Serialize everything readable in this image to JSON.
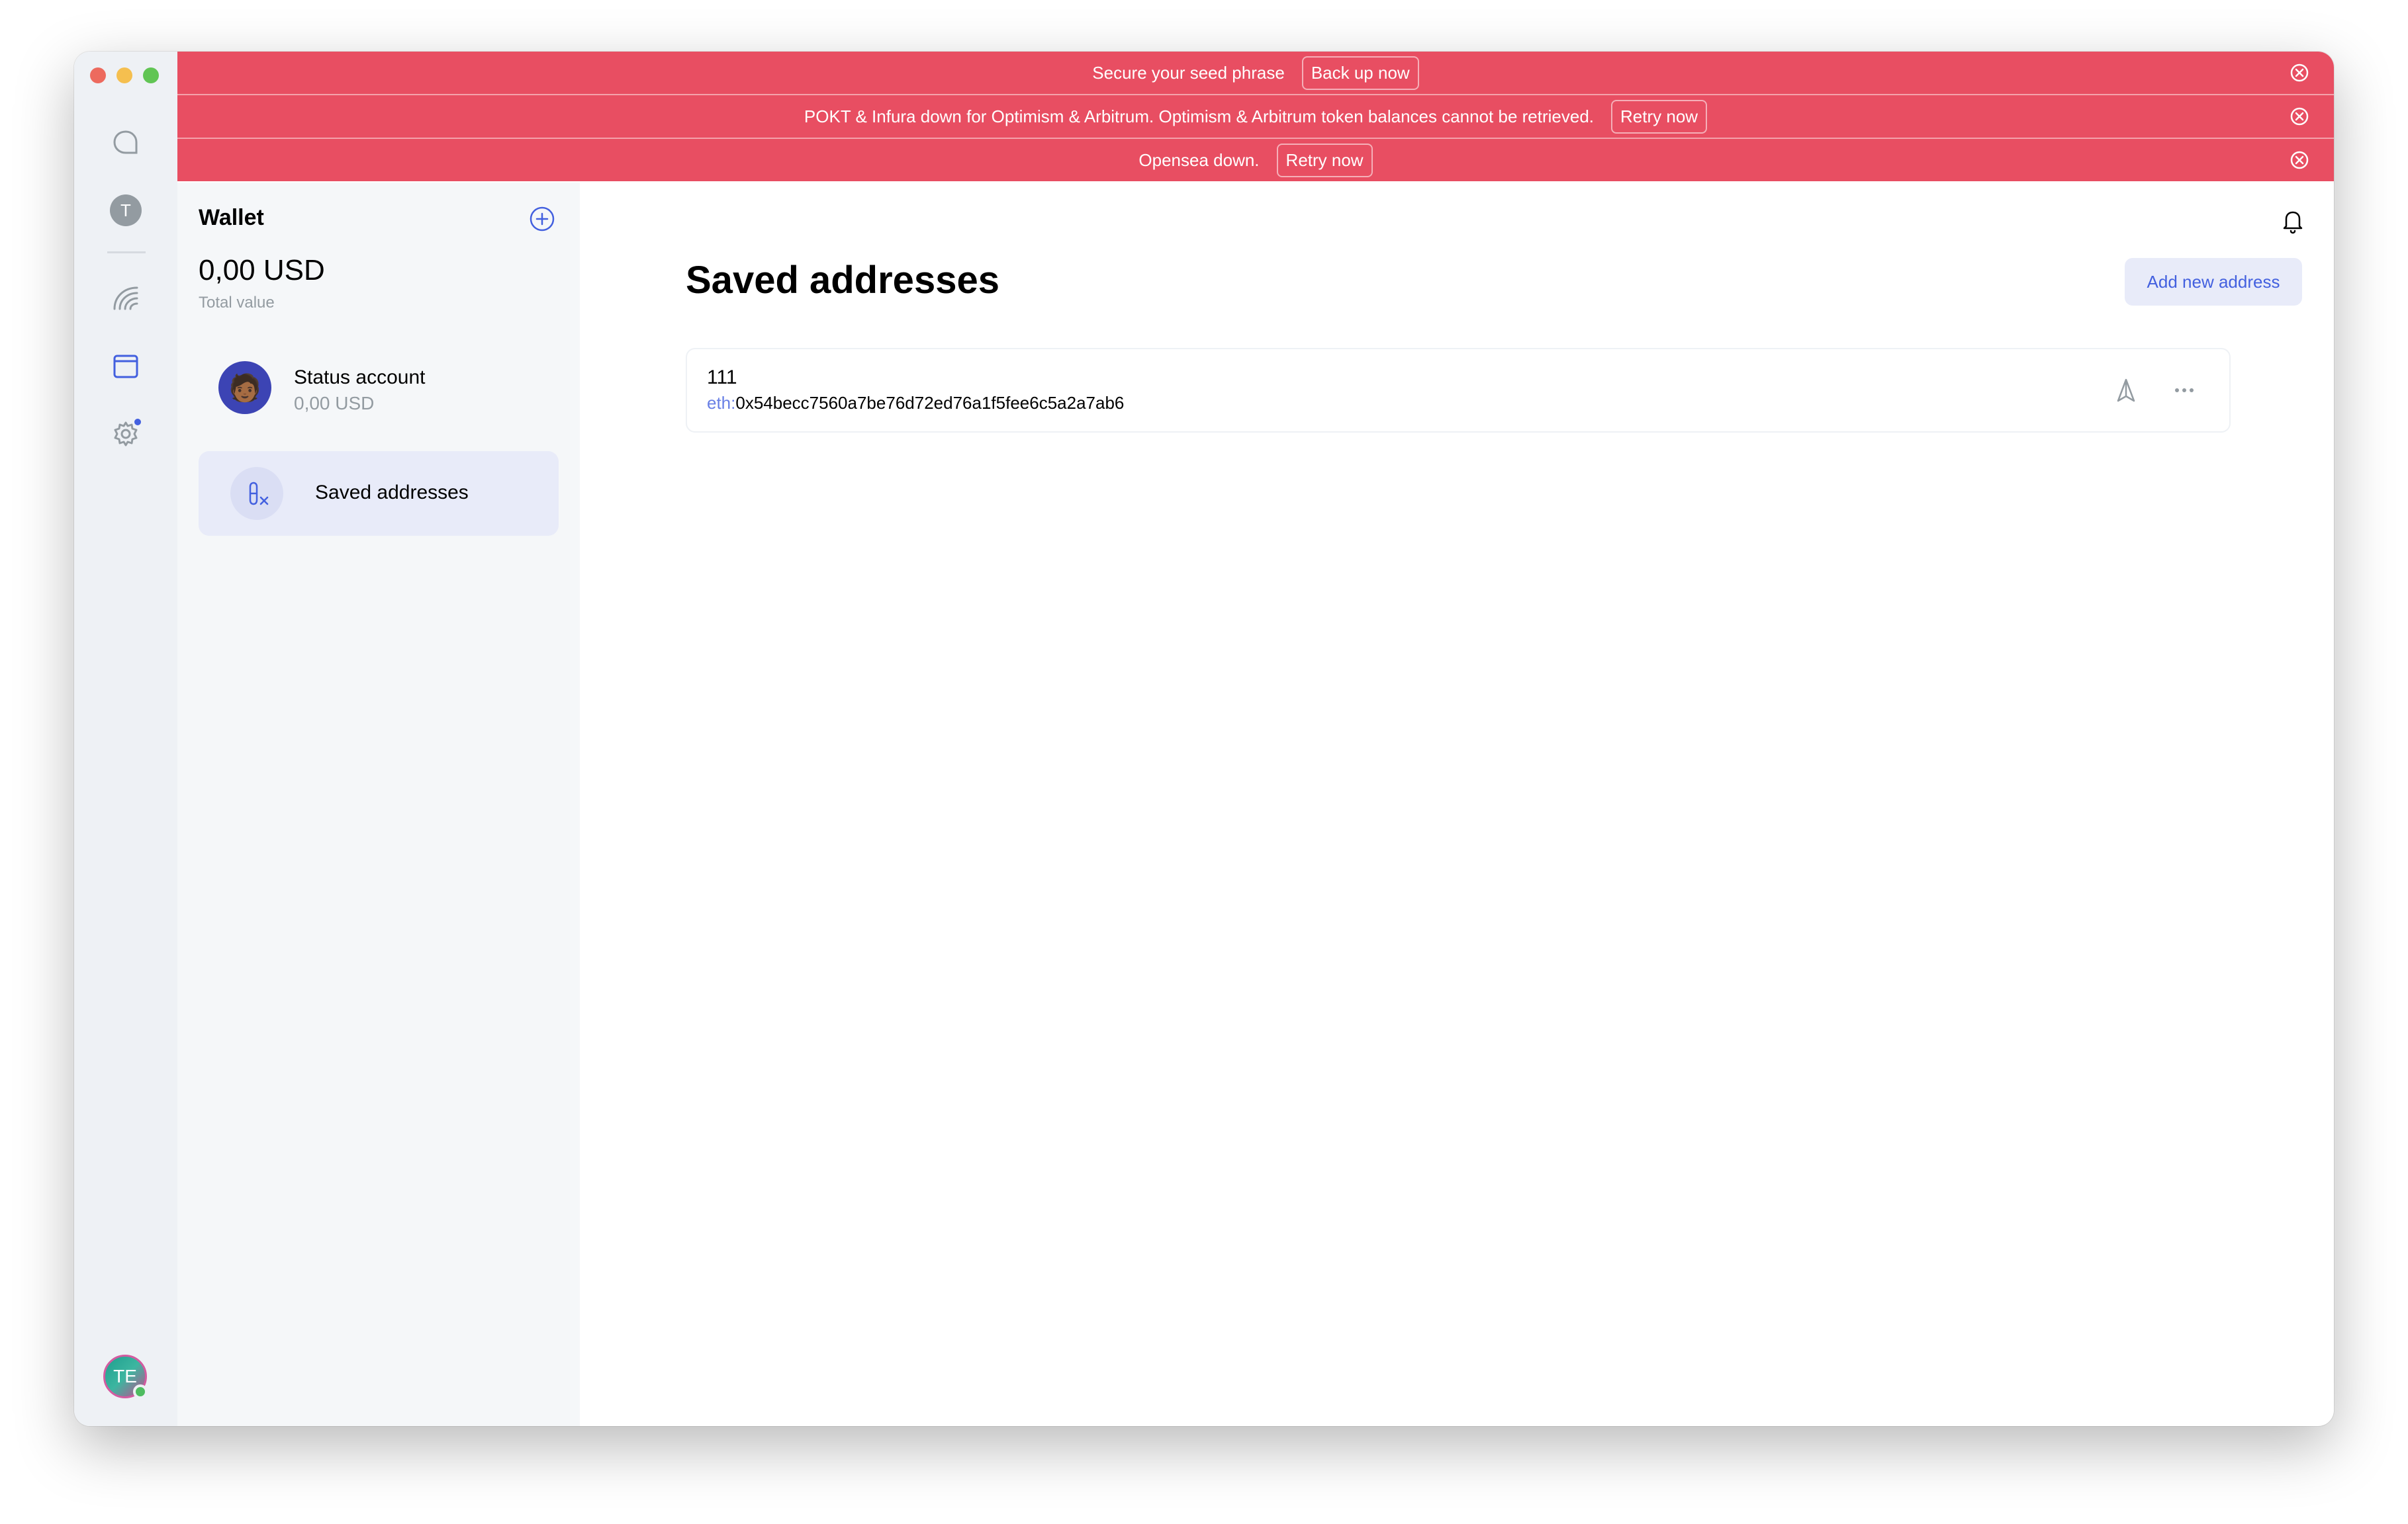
{
  "banners": [
    {
      "text": "Secure your seed phrase",
      "button": "Back up now"
    },
    {
      "text": "POKT & Infura down for Optimism & Arbitrum. Optimism & Arbitrum token balances cannot be retrieved.",
      "button": "Retry now"
    },
    {
      "text": "Opensea down.",
      "button": "Retry now"
    }
  ],
  "rail": {
    "items": [
      {
        "icon": "chat-icon"
      },
      {
        "icon": "community-avatar",
        "letter": "T"
      },
      {
        "icon": "wallet-icon"
      },
      {
        "icon": "browser-icon"
      },
      {
        "icon": "settings-icon"
      }
    ],
    "user_initials": "TE"
  },
  "wallet": {
    "title": "Wallet",
    "total": "0,00 USD",
    "total_label": "Total value",
    "accounts": [
      {
        "name": "Status account",
        "balance": "0,00 USD",
        "emoji": "🧑🏾"
      }
    ],
    "saved_addresses_label": "Saved addresses"
  },
  "main": {
    "title": "Saved addresses",
    "add_button": "Add new address",
    "addresses": [
      {
        "name": "111",
        "prefix": "eth:",
        "address": "0x54becc7560a7be76d72ed76a1f5fee6c5a2a7ab6"
      }
    ]
  },
  "colors": {
    "banner": "#e84e62",
    "accent": "#4360df",
    "rail": "#eef1f5",
    "panel": "#f5f7f9"
  }
}
